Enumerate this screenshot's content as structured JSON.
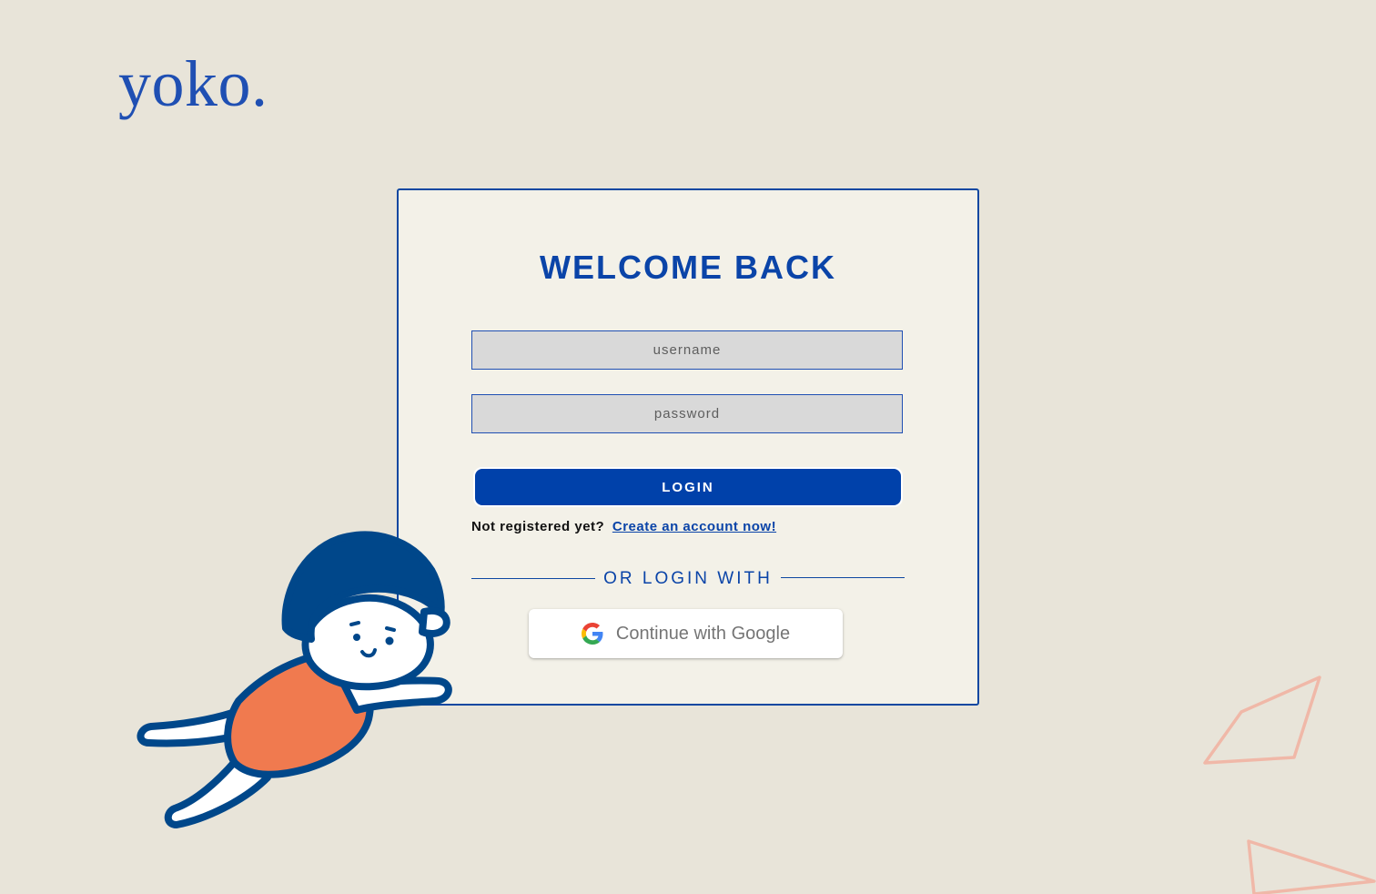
{
  "brand": {
    "logo_text": "yoko."
  },
  "login_card": {
    "title": "WELCOME BACK",
    "username": {
      "placeholder": "username",
      "value": ""
    },
    "password": {
      "placeholder": "password",
      "value": ""
    },
    "login_button_label": "LOGIN",
    "register_prompt": "Not registered yet?",
    "register_link_label": "Create an account now!",
    "divider_label": "OR LOGIN WITH",
    "google_button_label": "Continue with Google"
  },
  "icons": {
    "google": "google-g-logo",
    "mascot": "flying-child-illustration",
    "decoration": "paper-kite-outline"
  },
  "colors": {
    "background": "#e8e4d9",
    "card_background": "#f3f1e8",
    "accent_blue": "#0041aa",
    "input_background": "#d9d9d9",
    "mascot_hair": "#00478a",
    "mascot_shirt": "#f07a4f",
    "kite_stroke": "#f0b8a8"
  }
}
